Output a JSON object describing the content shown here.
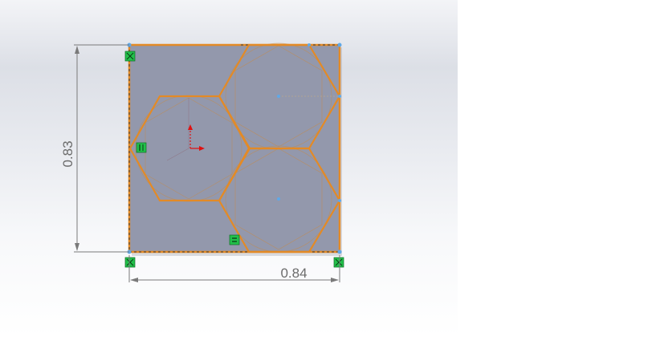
{
  "dimensions": {
    "height_value": "0.83",
    "width_value": "0.84"
  },
  "colors": {
    "viewport_top": "#f3f4f7",
    "face_fill": "#9398ac",
    "sketch_orange": "#e38a26",
    "dimension_line": "#7a7a7a",
    "relation_green": "#22c04a",
    "point_blue": "#5fa8e8",
    "origin_red": "#e01010"
  }
}
